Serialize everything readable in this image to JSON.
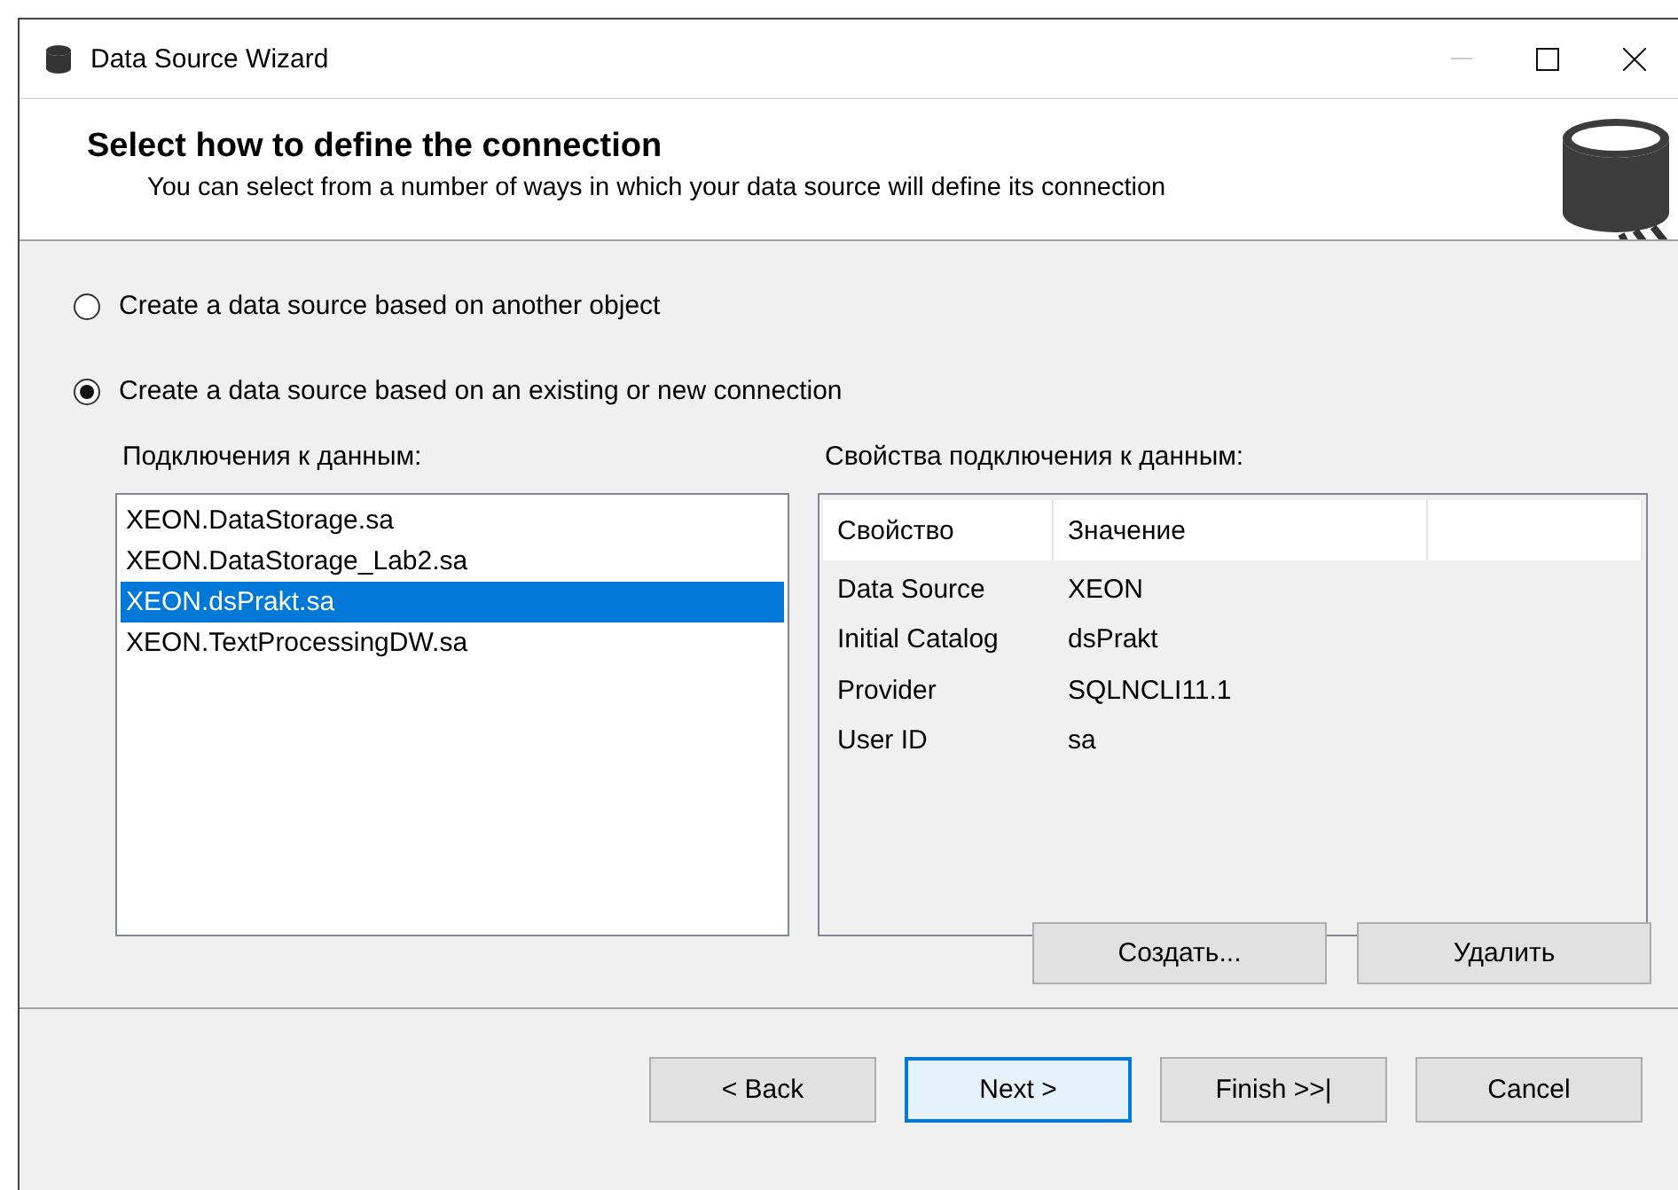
{
  "window": {
    "title": "Data Source Wizard"
  },
  "header": {
    "title": "Select how to define the connection",
    "subtitle": "You can select from a number of ways in which your data source will define its connection"
  },
  "options": [
    {
      "label": "Create a data source based on another object",
      "selected": false
    },
    {
      "label": "Create a data source based on an existing or new connection",
      "selected": true
    }
  ],
  "connections": {
    "label": "Подключения к данным:",
    "items": [
      {
        "label": "XEON.DataStorage.sa",
        "selected": false
      },
      {
        "label": "XEON.DataStorage_Lab2.sa",
        "selected": false
      },
      {
        "label": "XEON.dsPrakt.sa",
        "selected": true
      },
      {
        "label": "XEON.TextProcessingDW.sa",
        "selected": false
      }
    ]
  },
  "properties": {
    "label": "Свойства подключения к данным:",
    "columns": [
      "Свойство",
      "Значение"
    ],
    "rows": [
      [
        "Data Source",
        "XEON"
      ],
      [
        "Initial Catalog",
        "dsPrakt"
      ],
      [
        "Provider",
        "SQLNCLI11.1"
      ],
      [
        "User ID",
        "sa"
      ]
    ]
  },
  "connection_buttons": [
    "Создать...",
    "Удалить"
  ],
  "nav_buttons": [
    {
      "label": "< Back",
      "focused": false
    },
    {
      "label": "Next >",
      "focused": true
    },
    {
      "label": "Finish >>|",
      "focused": false
    },
    {
      "label": "Cancel",
      "focused": false
    }
  ]
}
